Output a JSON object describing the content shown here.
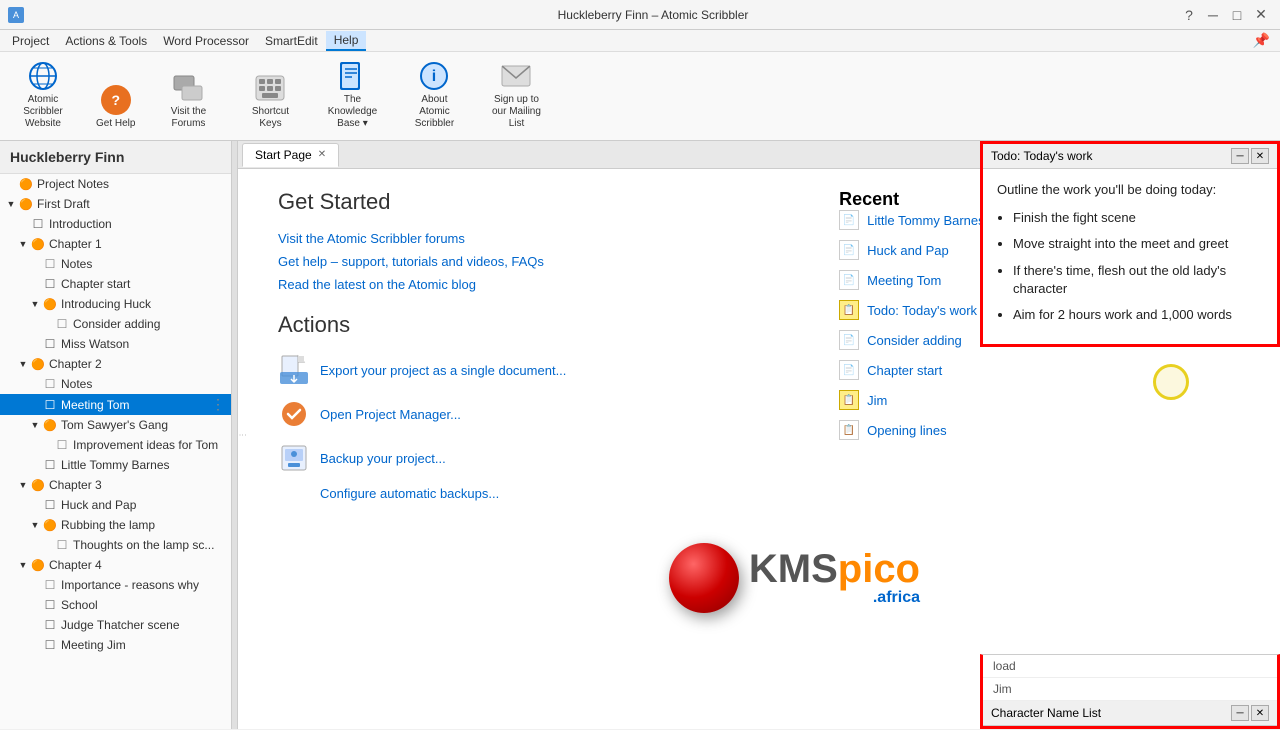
{
  "titleBar": {
    "title": "Huckleberry Finn – Atomic Scribbler",
    "controls": [
      "minimize",
      "maximize",
      "close"
    ]
  },
  "menuBar": {
    "items": [
      "Project",
      "Actions & Tools",
      "Word Processor",
      "SmartEdit",
      "Help"
    ],
    "activeItem": "Help"
  },
  "ribbon": {
    "buttons": [
      {
        "id": "atomic-scribbler-website",
        "label": "Atomic Scribbler\nWebsite",
        "iconColor": "#0066cc",
        "iconChar": "🌐"
      },
      {
        "id": "get-help",
        "label": "Get Help",
        "iconColor": "#e87020",
        "iconChar": "?"
      },
      {
        "id": "visit-forums",
        "label": "Visit the\nForums",
        "iconColor": "#888",
        "iconChar": "👥"
      },
      {
        "id": "shortcut-keys",
        "label": "Shortcut\nKeys",
        "iconColor": "#888",
        "iconChar": "⌨"
      },
      {
        "id": "knowledge-base",
        "label": "The Knowledge\nBase ▾",
        "iconColor": "#0066cc",
        "iconChar": "📖"
      },
      {
        "id": "about-atomic",
        "label": "About Atomic\nScribbler",
        "iconColor": "#0066cc",
        "iconChar": "ℹ"
      },
      {
        "id": "mailing-list",
        "label": "Sign up to our\nMailing List",
        "iconColor": "#888",
        "iconChar": "✉"
      }
    ]
  },
  "sidebar": {
    "title": "Huckleberry Finn",
    "items": [
      {
        "id": "project-notes",
        "label": "Project Notes",
        "indent": 0,
        "type": "folder",
        "expanded": false,
        "hasChevron": false
      },
      {
        "id": "first-draft",
        "label": "First Draft",
        "indent": 0,
        "type": "folder",
        "expanded": true,
        "hasChevron": true
      },
      {
        "id": "introduction",
        "label": "Introduction",
        "indent": 1,
        "type": "doc",
        "expanded": false,
        "hasChevron": false
      },
      {
        "id": "chapter-1",
        "label": "Chapter 1",
        "indent": 1,
        "type": "folder",
        "expanded": true,
        "hasChevron": true
      },
      {
        "id": "ch1-notes",
        "label": "Notes",
        "indent": 2,
        "type": "note",
        "expanded": false,
        "hasChevron": false
      },
      {
        "id": "chapter-start",
        "label": "Chapter start",
        "indent": 2,
        "type": "doc",
        "expanded": false,
        "hasChevron": false
      },
      {
        "id": "introducing-huck",
        "label": "Introducing Huck",
        "indent": 2,
        "type": "folder",
        "expanded": true,
        "hasChevron": true
      },
      {
        "id": "consider-adding",
        "label": "Consider adding",
        "indent": 3,
        "type": "note",
        "expanded": false,
        "hasChevron": false
      },
      {
        "id": "miss-watson",
        "label": "Miss Watson",
        "indent": 2,
        "type": "doc",
        "expanded": false,
        "hasChevron": false
      },
      {
        "id": "chapter-2",
        "label": "Chapter 2",
        "indent": 1,
        "type": "folder",
        "expanded": true,
        "hasChevron": true
      },
      {
        "id": "ch2-notes",
        "label": "Notes",
        "indent": 2,
        "type": "note",
        "expanded": false,
        "hasChevron": false
      },
      {
        "id": "meeting-tom",
        "label": "Meeting Tom",
        "indent": 2,
        "type": "doc",
        "expanded": false,
        "hasChevron": false,
        "selected": true
      },
      {
        "id": "tom-sawyers-gang",
        "label": "Tom Sawyer's Gang",
        "indent": 2,
        "type": "folder",
        "expanded": true,
        "hasChevron": true
      },
      {
        "id": "improvement-ideas",
        "label": "Improvement ideas for Tom",
        "indent": 3,
        "type": "note",
        "expanded": false,
        "hasChevron": false
      },
      {
        "id": "little-tommy",
        "label": "Little Tommy Barnes",
        "indent": 2,
        "type": "doc",
        "expanded": false,
        "hasChevron": false
      },
      {
        "id": "chapter-3",
        "label": "Chapter 3",
        "indent": 1,
        "type": "folder",
        "expanded": true,
        "hasChevron": true
      },
      {
        "id": "huck-pap",
        "label": "Huck and Pap",
        "indent": 2,
        "type": "doc",
        "expanded": false,
        "hasChevron": false
      },
      {
        "id": "rubbing-lamp",
        "label": "Rubbing the lamp",
        "indent": 2,
        "type": "folder",
        "expanded": true,
        "hasChevron": true
      },
      {
        "id": "thoughts-lamp",
        "label": "Thoughts on the lamp sc...",
        "indent": 3,
        "type": "note",
        "expanded": false,
        "hasChevron": false
      },
      {
        "id": "chapter-4",
        "label": "Chapter 4",
        "indent": 1,
        "type": "folder",
        "expanded": true,
        "hasChevron": true
      },
      {
        "id": "importance-reasons",
        "label": "Importance - reasons why",
        "indent": 2,
        "type": "note",
        "expanded": false,
        "hasChevron": false
      },
      {
        "id": "school",
        "label": "School",
        "indent": 2,
        "type": "doc",
        "expanded": false,
        "hasChevron": false
      },
      {
        "id": "judge-thatcher",
        "label": "Judge Thatcher scene",
        "indent": 2,
        "type": "doc",
        "expanded": false,
        "hasChevron": false
      },
      {
        "id": "meeting-jim",
        "label": "Meeting Jim",
        "indent": 2,
        "type": "doc",
        "expanded": false,
        "hasChevron": false
      }
    ]
  },
  "tabs": [
    {
      "id": "start-page",
      "label": "Start Page",
      "active": true,
      "closeable": true
    }
  ],
  "startPage": {
    "getStarted": {
      "heading": "Get Started",
      "links": [
        "Visit the Atomic Scribbler forums",
        "Get help – support, tutorials and videos, FAQs",
        "Read the latest on the Atomic blog"
      ]
    },
    "actions": {
      "heading": "Actions",
      "items": [
        {
          "id": "export",
          "label": "Export your project as a single document..."
        },
        {
          "id": "project-manager",
          "label": "Open Project Manager..."
        },
        {
          "id": "backup",
          "label": "Backup your project..."
        },
        {
          "id": "auto-backup",
          "label": "Configure automatic backups..."
        }
      ]
    },
    "recent": {
      "heading": "Recent",
      "items": [
        {
          "id": "little-tommy",
          "label": "Little Tommy Barnes",
          "type": "doc"
        },
        {
          "id": "huck-pap",
          "label": "Huck and Pap",
          "type": "doc"
        },
        {
          "id": "meeting-tom",
          "label": "Meeting Tom",
          "type": "doc"
        },
        {
          "id": "todo-work",
          "label": "Todo: Today's work",
          "type": "sticky"
        },
        {
          "id": "consider-adding-r",
          "label": "Consider adding",
          "type": "note"
        },
        {
          "id": "chapter-start-r",
          "label": "Chapter start",
          "type": "doc"
        },
        {
          "id": "jim",
          "label": "Jim",
          "type": "sticky"
        },
        {
          "id": "opening-lines",
          "label": "Opening lines",
          "type": "list"
        }
      ]
    }
  },
  "panels": {
    "todo": {
      "title": "Todo: Today's work",
      "intro": "Outline the work you'll be doing today:",
      "items": [
        "Finish the fight scene",
        "Move straight into the meet and greet",
        "If there's time, flesh out the old lady's character",
        "Aim for 2 hours work and 1,000 words"
      ]
    },
    "characterNameList": {
      "title": "Character Name List"
    }
  },
  "watermark": {
    "kms": "KMS",
    "pico": "pico",
    "africa": ".africa"
  }
}
